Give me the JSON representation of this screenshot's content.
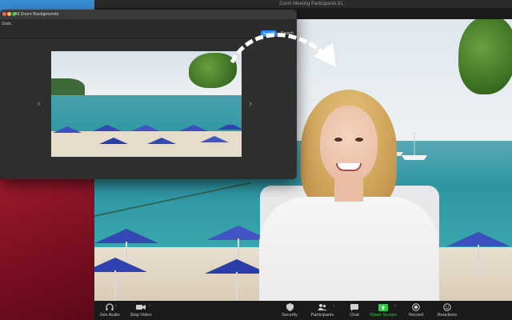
{
  "meeting_window": {
    "title": "Zoom Meeting Participants 81"
  },
  "dialog": {
    "title": "All Zoom Backgrounds",
    "tab_static": "Static",
    "primary_button": "Save All",
    "search_label": "Search",
    "prev_symbol": "‹",
    "next_symbol": "›"
  },
  "toolbar": {
    "items": [
      {
        "label": "Join Audio",
        "icon": "headphones-icon"
      },
      {
        "label": "Stop Video",
        "icon": "video-camera-icon"
      },
      {
        "label": "Security",
        "icon": "shield-icon"
      },
      {
        "label": "Participants",
        "icon": "participants-icon"
      },
      {
        "label": "Chat",
        "icon": "chat-icon"
      },
      {
        "label": "Share Screen",
        "icon": "share-screen-icon"
      },
      {
        "label": "Record",
        "icon": "record-icon"
      },
      {
        "label": "Reactions",
        "icon": "reactions-icon"
      }
    ],
    "caret": "^"
  },
  "colors": {
    "share_green": "#2ecc40",
    "accent_blue": "#2d8cff",
    "toolbar_bg": "#1a1a1a"
  }
}
